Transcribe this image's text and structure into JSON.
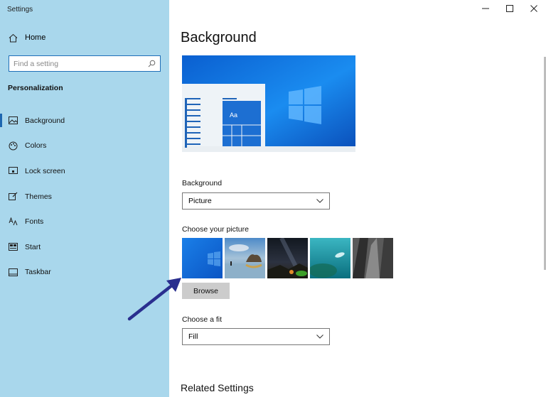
{
  "window": {
    "title": "Settings"
  },
  "sidebar": {
    "home_label": "Home",
    "search_placeholder": "Find a setting",
    "section_title": "Personalization",
    "items": [
      {
        "label": "Background",
        "icon": "picture-icon",
        "active": true
      },
      {
        "label": "Colors",
        "icon": "palette-icon"
      },
      {
        "label": "Lock screen",
        "icon": "lock-screen-icon"
      },
      {
        "label": "Themes",
        "icon": "brush-icon"
      },
      {
        "label": "Fonts",
        "icon": "font-icon"
      },
      {
        "label": "Start",
        "icon": "start-icon"
      },
      {
        "label": "Taskbar",
        "icon": "taskbar-icon"
      }
    ]
  },
  "main": {
    "title": "Background",
    "preview_tile_text": "Aa",
    "background_label": "Background",
    "background_value": "Picture",
    "choose_picture_label": "Choose your picture",
    "browse_label": "Browse",
    "fit_label": "Choose a fit",
    "fit_value": "Fill",
    "related_settings": "Related Settings"
  },
  "colors": {
    "sidebar_bg": "#a9d7ec",
    "accent": "#1e66b0",
    "annotation_arrow": "#2a2f8f"
  }
}
